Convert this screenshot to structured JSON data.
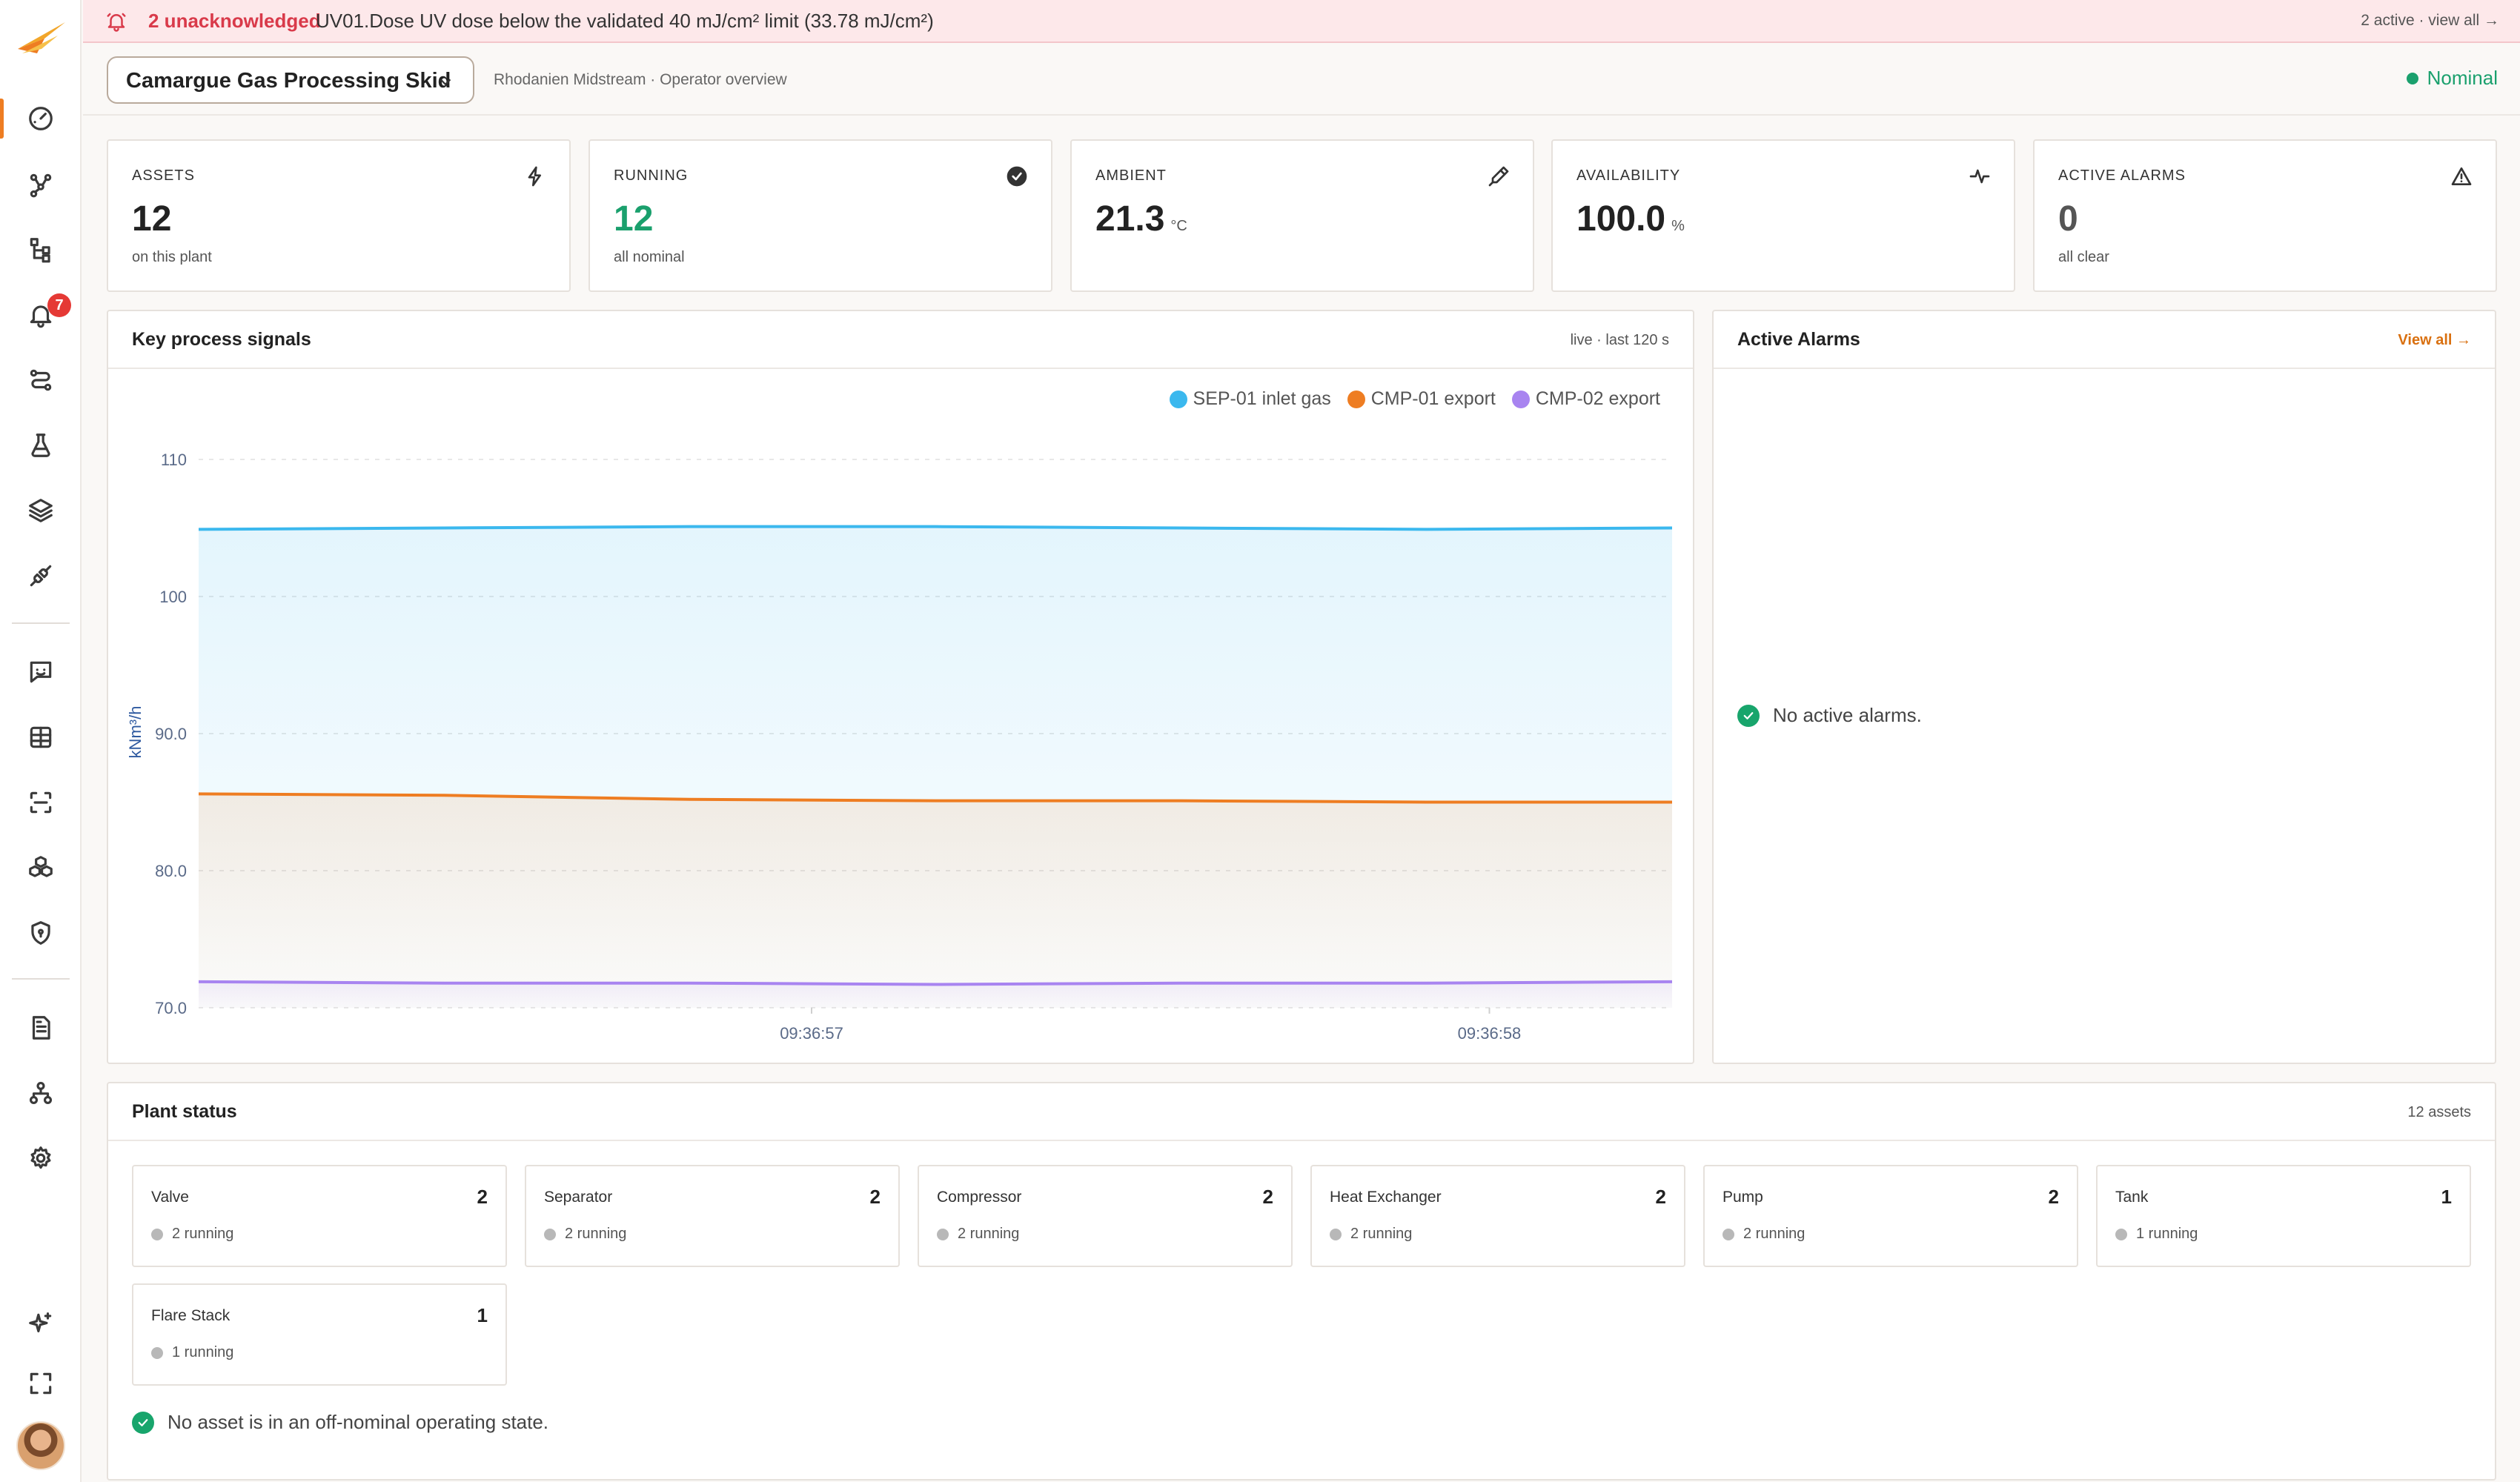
{
  "banner": {
    "unacknowledged": "2 unacknowledged",
    "message": "UV01.Dose UV dose below the validated 40 mJ/cm² limit (33.78 mJ/cm²)",
    "right": "2 active · view all →"
  },
  "sidebar": {
    "alarm_badge": "7",
    "items": [
      "dashboard-icon",
      "network-icon",
      "hierarchy-icon",
      "bell-icon",
      "route-icon",
      "flask-icon",
      "layers-icon",
      "plug-icon",
      "chat-icon",
      "table-icon",
      "scan-icon",
      "cubes-icon",
      "shield-icon",
      "document-icon",
      "org-icon",
      "gear-icon",
      "sparkle-icon",
      "fullscreen-icon"
    ]
  },
  "header": {
    "plant_name": "Camargue Gas Processing Skid",
    "subtitle": "Rhodanien Midstream · Operator overview",
    "status": "Nominal"
  },
  "kpis": [
    {
      "label": "ASSETS",
      "value": "12",
      "unit": "",
      "sub": "on this plant",
      "icon": "bolt-icon",
      "color": "#222222"
    },
    {
      "label": "RUNNING",
      "value": "12",
      "unit": "",
      "sub": "all nominal",
      "icon": "check-circle-icon",
      "color": "#1aa06d"
    },
    {
      "label": "AMBIENT",
      "value": "21.3",
      "unit": "°C",
      "sub": "",
      "icon": "thermometer-icon",
      "color": "#222222"
    },
    {
      "label": "AVAILABILITY",
      "value": "100.0",
      "unit": "%",
      "sub": "",
      "icon": "pulse-icon",
      "color": "#222222"
    },
    {
      "label": "ACTIVE ALARMS",
      "value": "0",
      "unit": "",
      "sub": "all clear",
      "icon": "warning-icon",
      "color": "#555555"
    }
  ],
  "signals_panel": {
    "title": "Key process signals",
    "right": "live · last 120 s"
  },
  "chart_data": {
    "type": "area",
    "ylabel": "kNm³/h",
    "yticks": [
      "110",
      "100",
      "90.0",
      "80.0",
      "70.0"
    ],
    "ylim": [
      70,
      110
    ],
    "xticks": [
      "09:36:57",
      "09:36:58"
    ],
    "grid": true,
    "legend_position": "top-right",
    "series": [
      {
        "name": "SEP-01 inlet gas",
        "color": "#3bb8ee",
        "values": [
          104.9,
          105.0,
          105.1,
          105.1,
          105.0,
          104.9,
          105.0
        ]
      },
      {
        "name": "CMP-01 export",
        "color": "#ee7d22",
        "values": [
          85.6,
          85.5,
          85.2,
          85.1,
          85.1,
          85.0,
          85.0
        ]
      },
      {
        "name": "CMP-02 export",
        "color": "#a884f0",
        "values": [
          71.9,
          71.8,
          71.8,
          71.7,
          71.8,
          71.8,
          71.9
        ]
      }
    ]
  },
  "alarms_panel": {
    "title": "Active Alarms",
    "link": "View all →",
    "empty": "No active alarms."
  },
  "plant_status": {
    "title": "Plant status",
    "right": "12 assets",
    "tiles": [
      {
        "name": "Valve",
        "count": "2",
        "running": "2 running"
      },
      {
        "name": "Separator",
        "count": "2",
        "running": "2 running"
      },
      {
        "name": "Compressor",
        "count": "2",
        "running": "2 running"
      },
      {
        "name": "Heat Exchanger",
        "count": "2",
        "running": "2 running"
      },
      {
        "name": "Pump",
        "count": "2",
        "running": "2 running"
      },
      {
        "name": "Tank",
        "count": "1",
        "running": "1 running"
      },
      {
        "name": "Flare Stack",
        "count": "1",
        "running": "1 running"
      }
    ],
    "footer": "No asset is in an off-nominal operating state."
  }
}
